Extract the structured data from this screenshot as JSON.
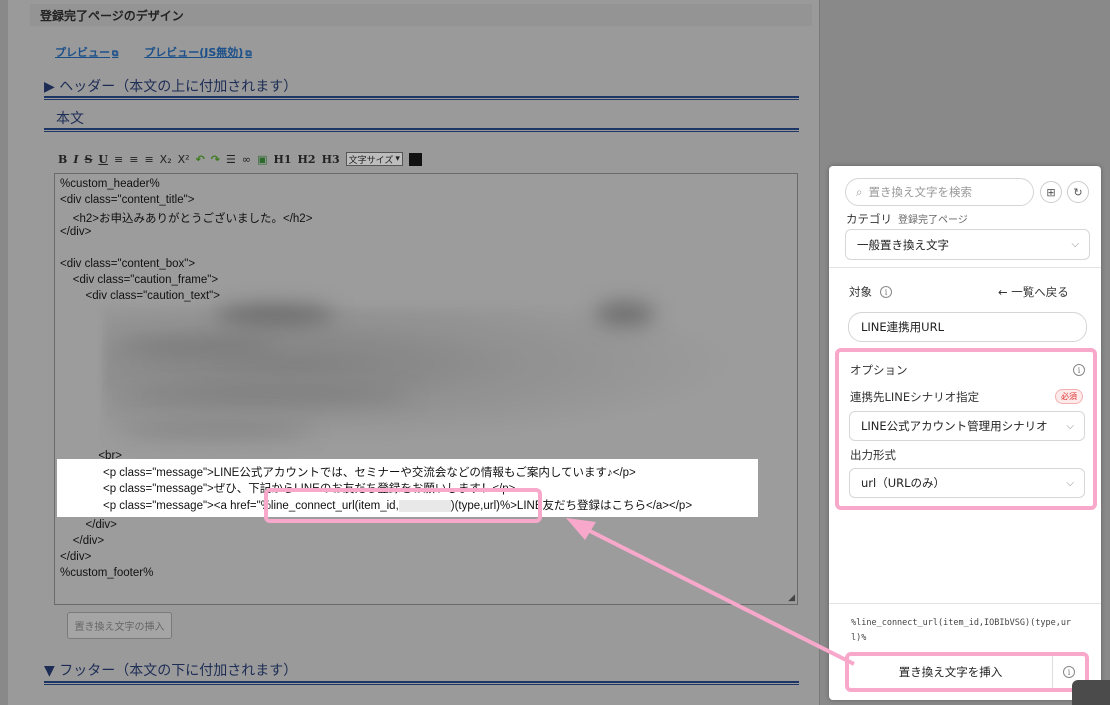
{
  "page_title": "登録完了ページのデザイン",
  "links": [
    {
      "label": "プレビュー"
    },
    {
      "label": "プレビュー(JS無効)"
    }
  ],
  "sections": {
    "header": "▶ ヘッダー（本文の上に付加されます）",
    "body": "本文",
    "footer": "▼ フッター（本文の下に付加されます）"
  },
  "toolbar": {
    "font_size_select": "文字サイズ"
  },
  "editor": {
    "lines": [
      "%custom_header%",
      "<div class=\"content_title\">",
      "    <h2>お申込みありがとうございました。</h2>",
      "</div>",
      "",
      "<div class=\"content_box\">",
      "    <div class=\"caution_frame\">",
      "        <div class=\"caution_text\">"
    ],
    "br_line": "            <br>",
    "highlight_lines": [
      "<p class=\"message\">LINE公式アカウントでは、セミナーや交流会などの情報もご案内しています♪</p>",
      "<p class=\"message\">ぜひ、下記からLINEのお友だち登録をお願いします！</p>"
    ],
    "link_line_prefix": "<p class=\"message\"><a href=",
    "link_line_code_a": "\"%line_connect_url(item_id,",
    "link_line_code_b": ")(type,url)%",
    "link_line_suffix": ">LINE友だち登録はこちら</a></p>",
    "closing_lines": [
      "        </div>",
      "    </div>",
      "</div>",
      "%custom_footer%"
    ]
  },
  "left_insert_button": "置き換え文字の挿入",
  "panel": {
    "search_placeholder": "置き換え文字を検索",
    "category_label": "カテゴリ",
    "category_sub": "登録完了ページ",
    "category_value": "一般置き換え文字",
    "target_label": "対象",
    "back_label": "←  一覧へ戻る",
    "target_value": "LINE連携用URL",
    "options_title": "オプション",
    "scenario_label": "連携先LINEシナリオ指定",
    "required_badge": "必須",
    "scenario_value": "LINE公式アカウント管理用シナリオ",
    "output_label": "出力形式",
    "output_value": "url（URLのみ）",
    "preview_code": "%line_connect_url(item_id,IOBIbVSG)(type,url)%",
    "insert_button": "置き換え文字を挿入"
  },
  "colors": {
    "highlight_pink": "#f8a8cb",
    "section_navy": "#1c3565",
    "link_blue": "#1b4f8a"
  }
}
